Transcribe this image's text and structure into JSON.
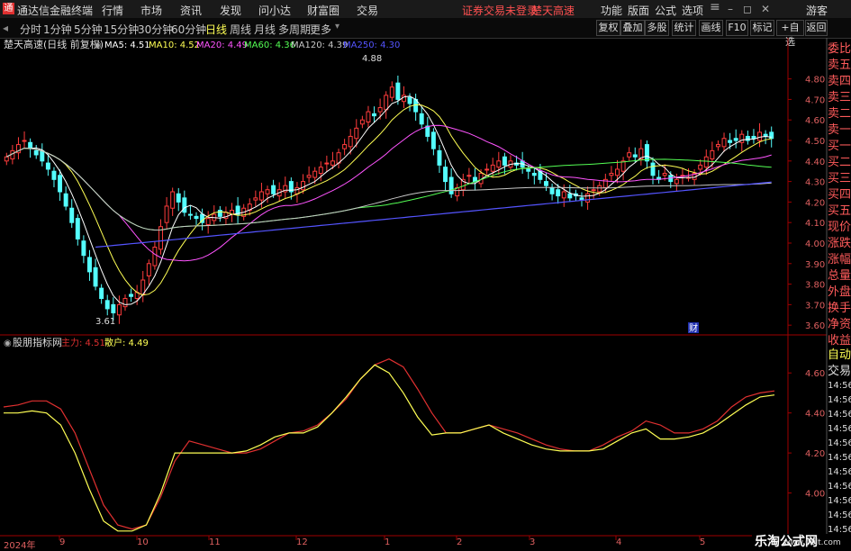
{
  "app": {
    "logo": "通",
    "title": "通达信金融终端",
    "menu": [
      "行情",
      "市场",
      "资讯",
      "发现",
      "问小达",
      "财富圈",
      "交易"
    ],
    "login_notice": "证券交易未登录",
    "ticker_notice": "楚天高速",
    "right_menu": [
      "功能",
      "版面",
      "公式",
      "选项"
    ],
    "user": "游客"
  },
  "toolbar": {
    "periods": [
      "分时",
      "1分钟",
      "5分钟",
      "15分钟",
      "30分钟",
      "60分钟",
      "日线",
      "周线",
      "月线",
      "多周期",
      "更多"
    ],
    "selected": "日线",
    "buttons": [
      "复权",
      "叠加",
      "多股",
      "统计",
      "画线",
      "F10",
      "标记",
      "+自选",
      "返回"
    ]
  },
  "sidebar": {
    "items": [
      "委比",
      "卖五",
      "卖四",
      "卖三",
      "卖二",
      "卖一",
      "买一",
      "买二",
      "买三",
      "买四",
      "买五",
      "现价",
      "涨跌",
      "涨幅",
      "总量",
      "外盘",
      "换手",
      "净资",
      "收益",
      "自动",
      "交易"
    ]
  },
  "time_labels": [
    "14:56",
    "14:56",
    "14:56",
    "14:56",
    "14:56",
    "14:56",
    "14:56",
    "14:56",
    "14:56",
    "14:56",
    "14:56"
  ],
  "main_chart": {
    "stock": "楚天高速",
    "mode": "(日线 前复权)",
    "indicators": [
      {
        "label": "MA5: 4.51",
        "color": "#ffffff"
      },
      {
        "label": "MA10: 4.52",
        "color": "#ffff54"
      },
      {
        "label": "MA20: 4.49",
        "color": "#ff54ff"
      },
      {
        "label": "MA60: 4.36",
        "color": "#54ff54"
      },
      {
        "label": "MA120: 4.39",
        "color": "#c8c8c8"
      },
      {
        "label": "MA250: 4.30",
        "color": "#5454ff"
      }
    ],
    "high_label": "4.88",
    "low_label": "3.61",
    "cai_marker": "财"
  },
  "sub_chart": {
    "name": "股朋指标网",
    "main_label": "主力: 4.51",
    "retail_label": "散户: 4.49"
  },
  "x_axis": {
    "labels": [
      "2024年",
      "9",
      "10",
      "11",
      "12",
      "1",
      "2",
      "3",
      "4",
      "5"
    ]
  },
  "watermark": {
    "text": "乐淘公式网",
    "url": "www.60lt.com"
  },
  "chart_data": [
    {
      "type": "candlestick",
      "title": "楚天高速 (日线 前复权)",
      "y_ticks": [
        4.8,
        4.7,
        4.6,
        4.5,
        4.4,
        4.3,
        4.2,
        4.1,
        4.0,
        3.9,
        3.8,
        3.7,
        3.6
      ],
      "ylim": [
        3.57,
        4.93
      ],
      "x_ticks": [
        "9",
        "10",
        "11",
        "12",
        "1",
        "2",
        "3",
        "4",
        "5"
      ],
      "high": 4.88,
      "low": 3.61,
      "close": [
        4.42,
        4.45,
        4.48,
        4.5,
        4.46,
        4.43,
        4.4,
        4.36,
        4.31,
        4.25,
        4.18,
        4.1,
        4.02,
        3.94,
        3.86,
        3.79,
        3.73,
        3.68,
        3.66,
        3.7,
        3.73,
        3.74,
        3.76,
        3.82,
        3.9,
        3.98,
        4.08,
        4.18,
        4.25,
        4.2,
        4.15,
        4.14,
        4.12,
        4.1,
        4.12,
        4.14,
        4.13,
        4.15,
        4.16,
        4.14,
        4.17,
        4.19,
        4.22,
        4.25,
        4.26,
        4.24,
        4.26,
        4.28,
        4.25,
        4.27,
        4.3,
        4.33,
        4.35,
        4.37,
        4.39,
        4.4,
        4.44,
        4.48,
        4.52,
        4.56,
        4.6,
        4.64,
        4.62,
        4.66,
        4.72,
        4.76,
        4.7,
        4.72,
        4.68,
        4.64,
        4.58,
        4.52,
        4.46,
        4.38,
        4.3,
        4.24,
        4.27,
        4.31,
        4.33,
        4.3,
        4.34,
        4.36,
        4.38,
        4.4,
        4.38,
        4.4,
        4.38,
        4.37,
        4.35,
        4.33,
        4.31,
        4.28,
        4.24,
        4.23,
        4.25,
        4.22,
        4.23,
        4.21,
        4.24,
        4.26,
        4.28,
        4.31,
        4.34,
        4.36,
        4.4,
        4.44,
        4.42,
        4.46,
        4.4,
        4.33,
        4.31,
        4.34,
        4.3,
        4.31,
        4.33,
        4.32,
        4.34,
        4.38,
        4.42,
        4.45,
        4.48,
        4.51,
        4.49,
        4.5,
        4.53,
        4.5,
        4.51,
        4.54,
        4.52,
        4.51
      ]
    },
    {
      "type": "line",
      "title": "股朋指标网",
      "y_ticks": [
        4.6,
        4.4,
        4.2,
        4.0
      ],
      "ylim": [
        3.8,
        4.7
      ],
      "series": [
        {
          "name": "主力",
          "color": "#e03030",
          "values": [
            4.43,
            4.44,
            4.46,
            4.46,
            4.42,
            4.3,
            4.12,
            3.94,
            3.84,
            3.82,
            3.84,
            3.98,
            4.16,
            4.26,
            4.24,
            4.22,
            4.2,
            4.2,
            4.22,
            4.26,
            4.3,
            4.31,
            4.34,
            4.4,
            4.47,
            4.57,
            4.64,
            4.67,
            4.63,
            4.52,
            4.4,
            4.3,
            4.3,
            4.32,
            4.34,
            4.32,
            4.3,
            4.27,
            4.24,
            4.22,
            4.21,
            4.21,
            4.24,
            4.28,
            4.31,
            4.36,
            4.34,
            4.3,
            4.3,
            4.32,
            4.36,
            4.43,
            4.48,
            4.5,
            4.51
          ]
        },
        {
          "name": "散户",
          "color": "#ffff54",
          "values": [
            4.4,
            4.4,
            4.41,
            4.4,
            4.34,
            4.2,
            4.02,
            3.86,
            3.81,
            3.81,
            3.84,
            4.0,
            4.2,
            4.2,
            4.2,
            4.2,
            4.2,
            4.21,
            4.24,
            4.28,
            4.3,
            4.3,
            4.33,
            4.4,
            4.48,
            4.57,
            4.64,
            4.6,
            4.5,
            4.38,
            4.29,
            4.3,
            4.3,
            4.32,
            4.34,
            4.3,
            4.27,
            4.24,
            4.22,
            4.21,
            4.21,
            4.21,
            4.22,
            4.26,
            4.3,
            4.32,
            4.27,
            4.27,
            4.28,
            4.3,
            4.34,
            4.39,
            4.44,
            4.48,
            4.49
          ]
        }
      ]
    }
  ]
}
